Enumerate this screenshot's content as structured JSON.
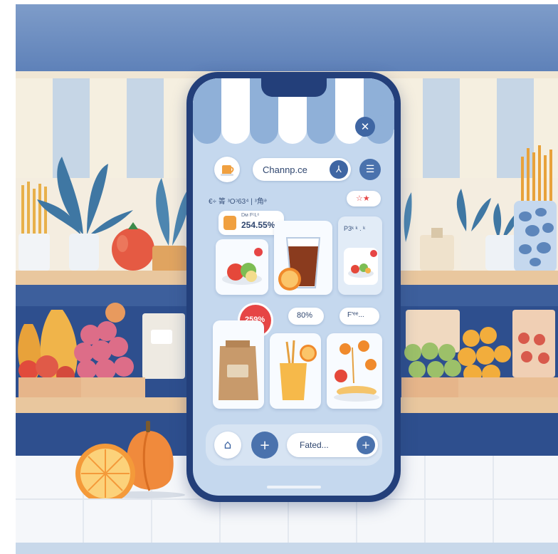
{
  "app": {
    "search_value": "Channp.ce",
    "stats_text": "€÷ 箐 ᵌOᵓ63⁴ | ᵌ角ᵊ",
    "rating_badge": "☆★",
    "promo_value": "254.55%",
    "promo_small": "Dᴍ FᶜLᵉ",
    "side_label": "P3ᵏ ᵏ . ᵏ",
    "discount_badge": "259%",
    "percent_chip": "80%",
    "filter_chip": "F'ᵉᵉ...",
    "bottom_input_value": "Fated...",
    "icons": [
      "close-icon",
      "search-icon",
      "menu-icon",
      "home-icon",
      "plus-icon"
    ]
  },
  "colors": {
    "phone_frame": "#233f7a",
    "screen_bg": "#c5d8ee",
    "accent_blue": "#4a72ad",
    "badge_red": "#e64545"
  }
}
